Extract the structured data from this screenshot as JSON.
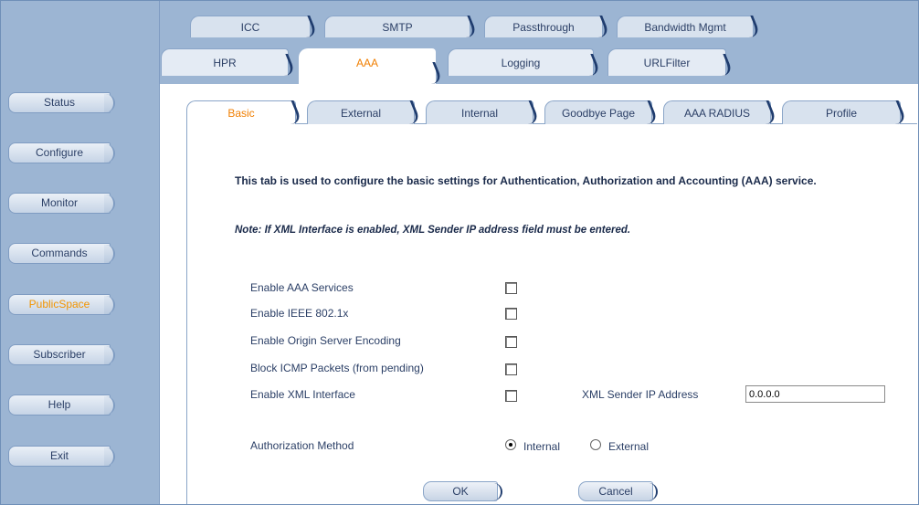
{
  "sidebar": {
    "items": [
      {
        "label": "Status"
      },
      {
        "label": "Configure"
      },
      {
        "label": "Monitor"
      },
      {
        "label": "Commands"
      },
      {
        "label": "PublicSpace"
      },
      {
        "label": "Subscriber"
      },
      {
        "label": "Help"
      },
      {
        "label": "Exit"
      }
    ],
    "active": "PublicSpace"
  },
  "top_tabs": {
    "row1": [
      {
        "label": "ICC"
      },
      {
        "label": "SMTP"
      },
      {
        "label": "Passthrough"
      },
      {
        "label": "Bandwidth Mgmt"
      }
    ],
    "row2": [
      {
        "label": "HPR"
      },
      {
        "label": "AAA"
      },
      {
        "label": "Logging"
      },
      {
        "label": "URLFilter"
      }
    ],
    "active": "AAA"
  },
  "sub_tabs": {
    "items": [
      {
        "label": "Basic"
      },
      {
        "label": "External"
      },
      {
        "label": "Internal"
      },
      {
        "label": "Goodbye Page"
      },
      {
        "label": "AAA RADIUS"
      },
      {
        "label": "Profile"
      }
    ],
    "active": "Basic"
  },
  "content": {
    "intro": "This tab is used to configure the basic settings for Authentication, Authorization and Accounting (AAA) service.",
    "note": "Note: If XML Interface is enabled, XML Sender IP address field must be entered.",
    "options": [
      {
        "label": "Enable AAA Services",
        "checked": false
      },
      {
        "label": "Enable IEEE 802.1x",
        "checked": false
      },
      {
        "label": "Enable Origin Server Encoding",
        "checked": false
      },
      {
        "label": "Block ICMP Packets (from pending)",
        "checked": false
      },
      {
        "label": "Enable XML Interface",
        "checked": false
      }
    ],
    "xml_sender": {
      "label": "XML Sender IP Address",
      "value": "0.0.0.0"
    },
    "auth_method": {
      "label": "Authorization Method",
      "options": [
        {
          "label": "Internal",
          "selected": true
        },
        {
          "label": "External",
          "selected": false
        }
      ]
    },
    "buttons": {
      "ok": "OK",
      "cancel": "Cancel"
    }
  },
  "colors": {
    "sidebar_bg": "#9cb5d3",
    "active_accent": "#f07e00",
    "text": "#2b3f66"
  }
}
